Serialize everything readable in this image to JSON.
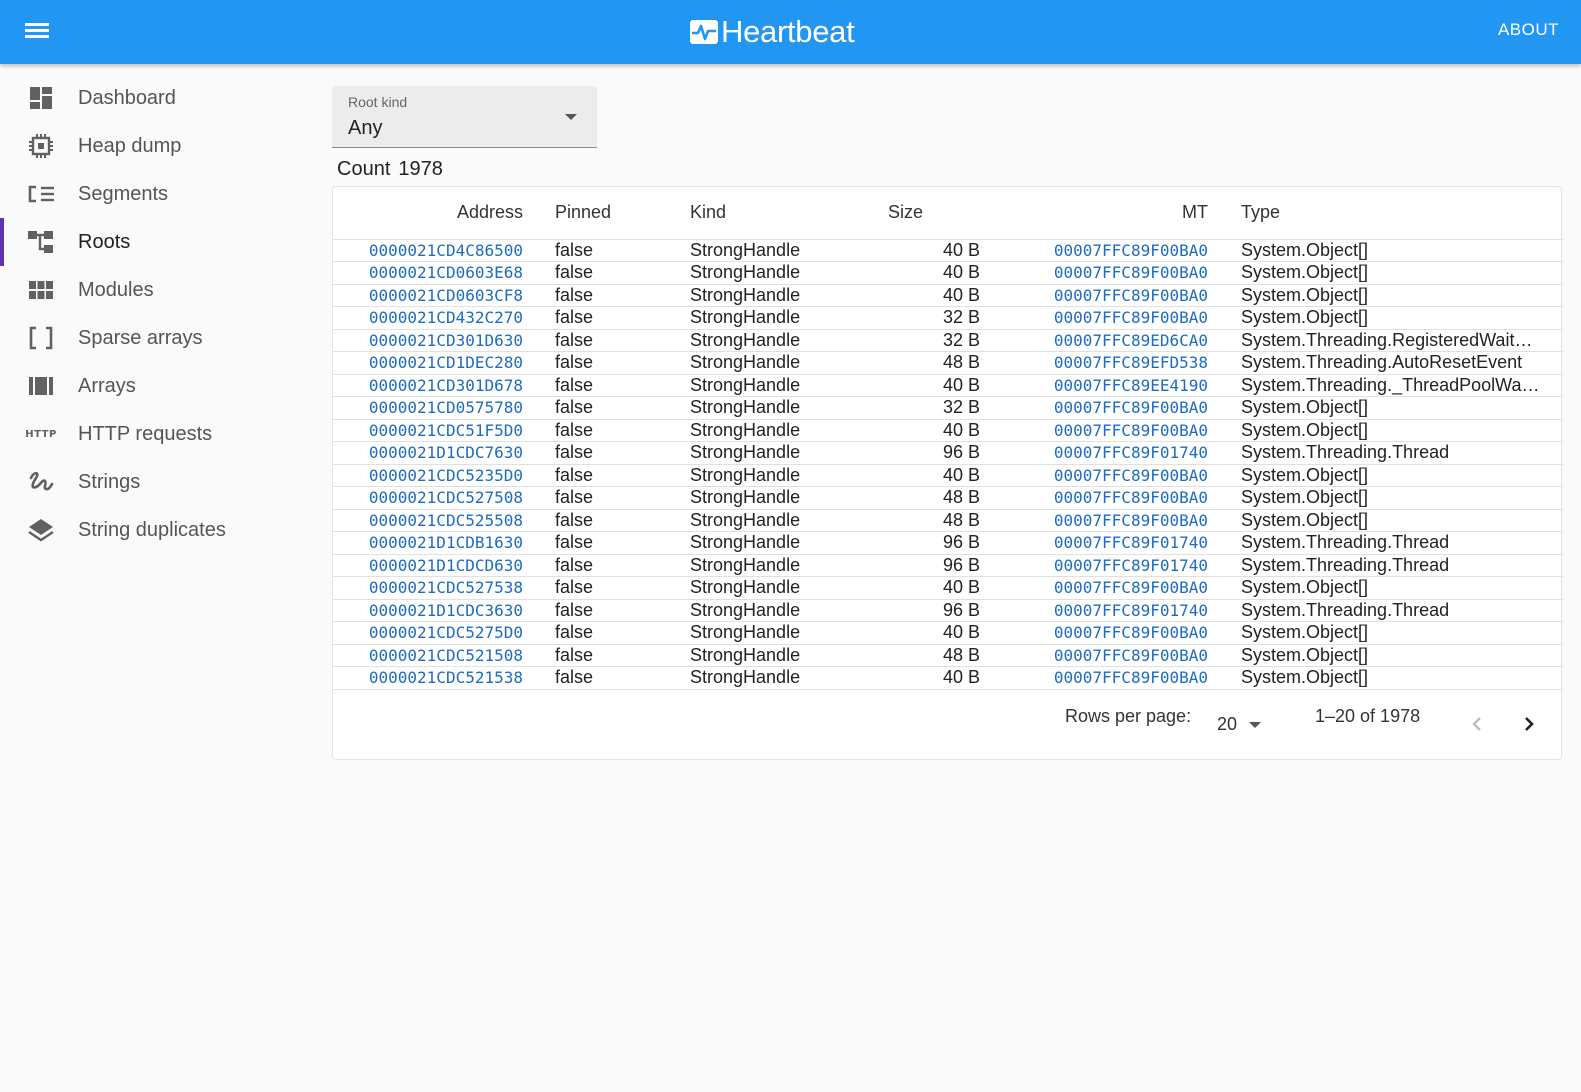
{
  "appbar": {
    "title": "Heartbeat",
    "about_label": "ABOUT"
  },
  "sidebar": {
    "items": [
      {
        "label": "Dashboard",
        "icon": "dashboard-icon"
      },
      {
        "label": "Heap dump",
        "icon": "chip-icon"
      },
      {
        "label": "Segments",
        "icon": "segments-icon"
      },
      {
        "label": "Roots",
        "icon": "tree-icon",
        "active": true
      },
      {
        "label": "Modules",
        "icon": "modules-icon"
      },
      {
        "label": "Sparse arrays",
        "icon": "brackets-icon"
      },
      {
        "label": "Arrays",
        "icon": "arrays-icon"
      },
      {
        "label": "HTTP requests",
        "icon": "http-icon"
      },
      {
        "label": "Strings",
        "icon": "strings-icon"
      },
      {
        "label": "String duplicates",
        "icon": "layers-icon"
      }
    ],
    "http_icon_text": "HTTP"
  },
  "filter": {
    "label": "Root kind",
    "value": "Any"
  },
  "count": {
    "label": "Count",
    "value": "1978"
  },
  "table": {
    "columns": [
      "Address",
      "Pinned",
      "Kind",
      "Size",
      "MT",
      "Type"
    ],
    "rows": [
      [
        "0000021CD4C86500",
        "false",
        "StrongHandle",
        "40 B",
        "00007FFC89F00BA0",
        "System.Object[]"
      ],
      [
        "0000021CD0603E68",
        "false",
        "StrongHandle",
        "40 B",
        "00007FFC89F00BA0",
        "System.Object[]"
      ],
      [
        "0000021CD0603CF8",
        "false",
        "StrongHandle",
        "40 B",
        "00007FFC89F00BA0",
        "System.Object[]"
      ],
      [
        "0000021CD432C270",
        "false",
        "StrongHandle",
        "32 B",
        "00007FFC89F00BA0",
        "System.Object[]"
      ],
      [
        "0000021CD301D630",
        "false",
        "StrongHandle",
        "32 B",
        "00007FFC89ED6CA0",
        "System.Threading.RegisteredWaitH…"
      ],
      [
        "0000021CD1DEC280",
        "false",
        "StrongHandle",
        "48 B",
        "00007FFC89EFD538",
        "System.Threading.AutoResetEvent"
      ],
      [
        "0000021CD301D678",
        "false",
        "StrongHandle",
        "40 B",
        "00007FFC89EE4190",
        "System.Threading._ThreadPoolWait…"
      ],
      [
        "0000021CD0575780",
        "false",
        "StrongHandle",
        "32 B",
        "00007FFC89F00BA0",
        "System.Object[]"
      ],
      [
        "0000021CDC51F5D0",
        "false",
        "StrongHandle",
        "40 B",
        "00007FFC89F00BA0",
        "System.Object[]"
      ],
      [
        "0000021D1CDC7630",
        "false",
        "StrongHandle",
        "96 B",
        "00007FFC89F01740",
        "System.Threading.Thread"
      ],
      [
        "0000021CDC5235D0",
        "false",
        "StrongHandle",
        "40 B",
        "00007FFC89F00BA0",
        "System.Object[]"
      ],
      [
        "0000021CDC527508",
        "false",
        "StrongHandle",
        "48 B",
        "00007FFC89F00BA0",
        "System.Object[]"
      ],
      [
        "0000021CDC525508",
        "false",
        "StrongHandle",
        "48 B",
        "00007FFC89F00BA0",
        "System.Object[]"
      ],
      [
        "0000021D1CDB1630",
        "false",
        "StrongHandle",
        "96 B",
        "00007FFC89F01740",
        "System.Threading.Thread"
      ],
      [
        "0000021D1CDCD630",
        "false",
        "StrongHandle",
        "96 B",
        "00007FFC89F01740",
        "System.Threading.Thread"
      ],
      [
        "0000021CDC527538",
        "false",
        "StrongHandle",
        "40 B",
        "00007FFC89F00BA0",
        "System.Object[]"
      ],
      [
        "0000021D1CDC3630",
        "false",
        "StrongHandle",
        "96 B",
        "00007FFC89F01740",
        "System.Threading.Thread"
      ],
      [
        "0000021CDC5275D0",
        "false",
        "StrongHandle",
        "40 B",
        "00007FFC89F00BA0",
        "System.Object[]"
      ],
      [
        "0000021CDC521508",
        "false",
        "StrongHandle",
        "48 B",
        "00007FFC89F00BA0",
        "System.Object[]"
      ],
      [
        "0000021CDC521538",
        "false",
        "StrongHandle",
        "40 B",
        "00007FFC89F00BA0",
        "System.Object[]"
      ]
    ]
  },
  "pagination": {
    "rows_per_page_label": "Rows per page:",
    "rows_per_page_value": "20",
    "range_text": "1–20 of 1978"
  },
  "colors": {
    "appbar": "#2196f3",
    "link": "#1e6bc2",
    "active_indicator": "#5e35b1"
  }
}
